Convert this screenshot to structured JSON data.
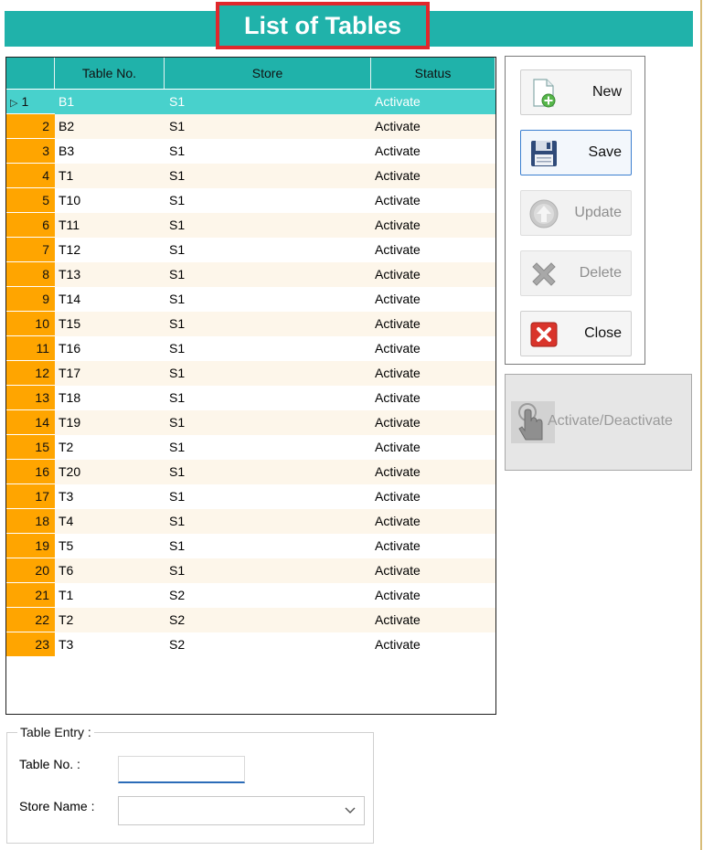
{
  "header": {
    "title": "List of Tables",
    "accent": "#20b2aa",
    "title_border": "#e0282c"
  },
  "grid": {
    "columns": [
      "",
      "Table No.",
      "Store",
      "Status"
    ],
    "selected_row": 1,
    "rows": [
      {
        "n": "1",
        "table_no": "B1",
        "store": "S1",
        "status": "Activate"
      },
      {
        "n": "2",
        "table_no": "B2",
        "store": "S1",
        "status": "Activate"
      },
      {
        "n": "3",
        "table_no": "B3",
        "store": "S1",
        "status": "Activate"
      },
      {
        "n": "4",
        "table_no": "T1",
        "store": "S1",
        "status": "Activate"
      },
      {
        "n": "5",
        "table_no": "T10",
        "store": "S1",
        "status": "Activate"
      },
      {
        "n": "6",
        "table_no": "T11",
        "store": "S1",
        "status": "Activate"
      },
      {
        "n": "7",
        "table_no": "T12",
        "store": "S1",
        "status": "Activate"
      },
      {
        "n": "8",
        "table_no": "T13",
        "store": "S1",
        "status": "Activate"
      },
      {
        "n": "9",
        "table_no": "T14",
        "store": "S1",
        "status": "Activate"
      },
      {
        "n": "10",
        "table_no": "T15",
        "store": "S1",
        "status": "Activate"
      },
      {
        "n": "11",
        "table_no": "T16",
        "store": "S1",
        "status": "Activate"
      },
      {
        "n": "12",
        "table_no": "T17",
        "store": "S1",
        "status": "Activate"
      },
      {
        "n": "13",
        "table_no": "T18",
        "store": "S1",
        "status": "Activate"
      },
      {
        "n": "14",
        "table_no": "T19",
        "store": "S1",
        "status": "Activate"
      },
      {
        "n": "15",
        "table_no": "T2",
        "store": "S1",
        "status": "Activate"
      },
      {
        "n": "16",
        "table_no": "T20",
        "store": "S1",
        "status": "Activate"
      },
      {
        "n": "17",
        "table_no": "T3",
        "store": "S1",
        "status": "Activate"
      },
      {
        "n": "18",
        "table_no": "T4",
        "store": "S1",
        "status": "Activate"
      },
      {
        "n": "19",
        "table_no": "T5",
        "store": "S1",
        "status": "Activate"
      },
      {
        "n": "20",
        "table_no": "T6",
        "store": "S1",
        "status": "Activate"
      },
      {
        "n": "21",
        "table_no": "T1",
        "store": "S2",
        "status": "Activate"
      },
      {
        "n": "22",
        "table_no": "T2",
        "store": "S2",
        "status": "Activate"
      },
      {
        "n": "23",
        "table_no": "T3",
        "store": "S2",
        "status": "Activate"
      }
    ]
  },
  "buttons": {
    "new": {
      "label": "New",
      "icon": "new-document-icon"
    },
    "save": {
      "label": "Save",
      "icon": "floppy-disk-icon"
    },
    "update": {
      "label": "Update",
      "icon": "up-arrow-circle-icon"
    },
    "delete": {
      "label": "Delete",
      "icon": "delete-x-icon"
    },
    "close": {
      "label": "Close",
      "icon": "close-x-icon"
    },
    "activate": {
      "label": "Activate/Deactivate",
      "icon": "hand-pointer-icon"
    }
  },
  "entry": {
    "legend": "Table Entry :",
    "table_no_label": "Table No. :",
    "table_no_value": "",
    "store_label": "Store Name :",
    "store_value": ""
  }
}
